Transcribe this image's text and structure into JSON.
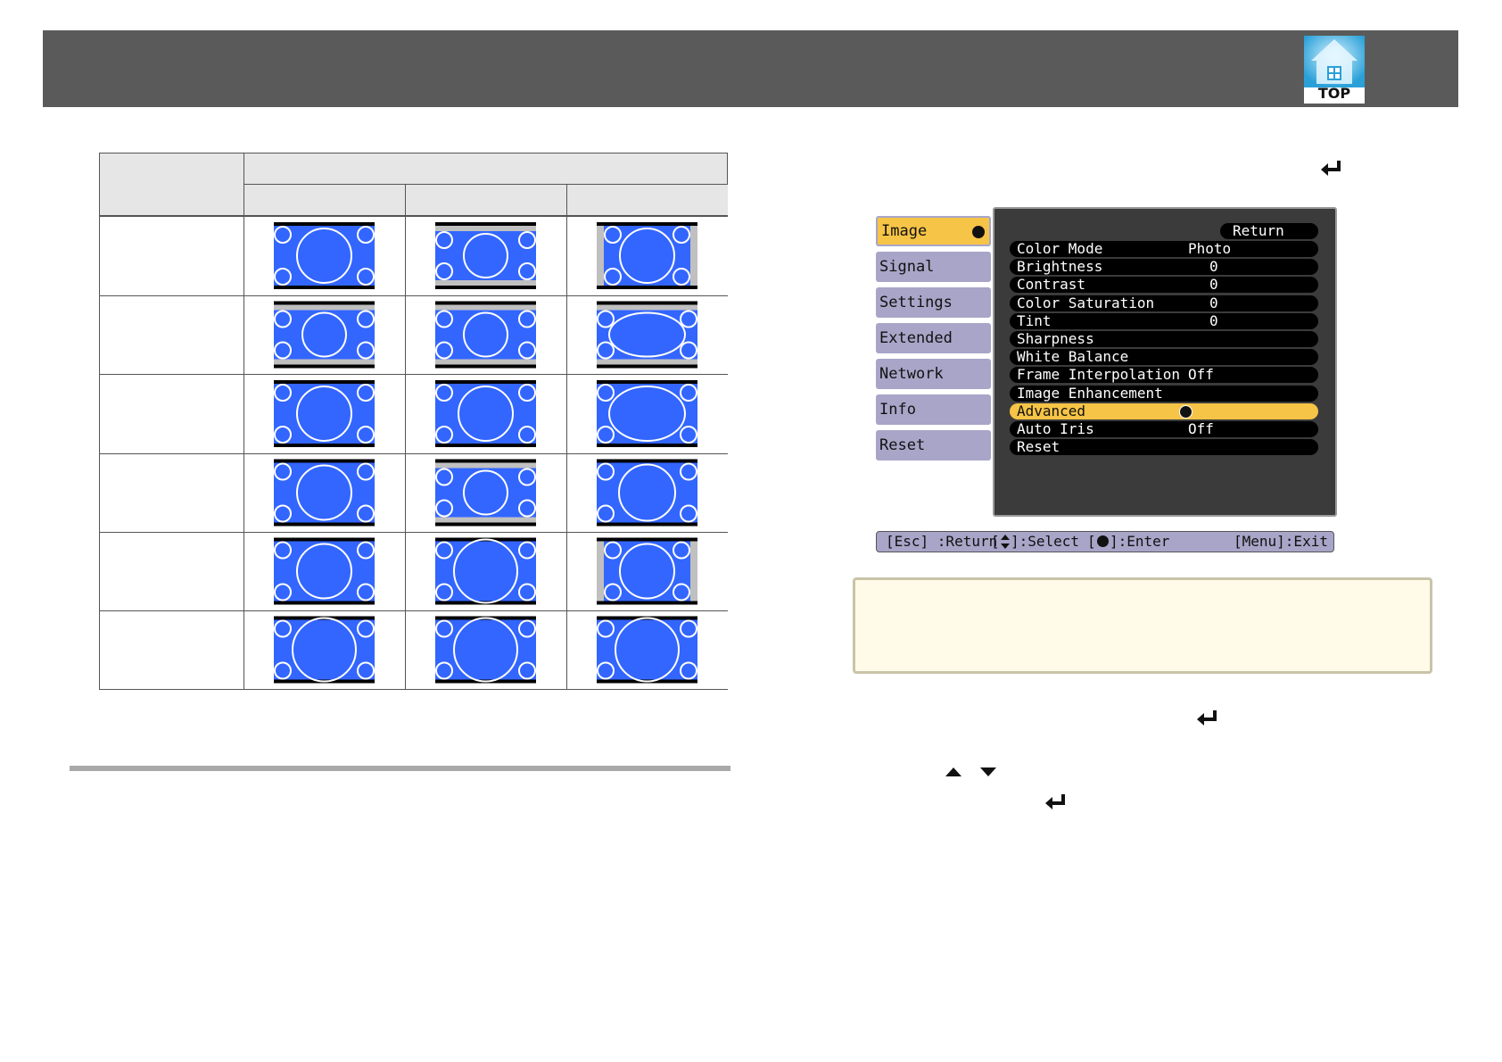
{
  "header": {
    "logo_label": "TOP",
    "logo_icon": "home-icon"
  },
  "aspect_table": {
    "rows": 6,
    "columns": 3,
    "colors": {
      "screen": "#3366ff",
      "letterbox": "#000000",
      "sidebar": "#c0c0c0"
    }
  },
  "menu": {
    "tabs": [
      "Image",
      "Signal",
      "Settings",
      "Extended",
      "Network",
      "Info",
      "Reset"
    ],
    "active_tab": "Image",
    "return_label": "Return",
    "items": [
      {
        "label": "Color Mode",
        "value": "Photo"
      },
      {
        "label": "Brightness",
        "value": "0"
      },
      {
        "label": "Contrast",
        "value": "0"
      },
      {
        "label": "Color Saturation",
        "value": "0"
      },
      {
        "label": "Tint",
        "value": "0"
      },
      {
        "label": "Sharpness",
        "value": ""
      },
      {
        "label": "White Balance",
        "value": ""
      },
      {
        "label": "Frame Interpolation",
        "value": "Off"
      },
      {
        "label": "Image Enhancement",
        "value": ""
      },
      {
        "label": "Advanced",
        "value": ""
      },
      {
        "label": "Auto Iris",
        "value": "Off"
      },
      {
        "label": "Reset",
        "value": ""
      }
    ],
    "highlighted_item": "Advanced",
    "footer": {
      "esc": "[Esc] :Return",
      "select_pre": "[",
      "select_post": "]:Select",
      "enter_pre": "[",
      "enter_post": "]:Enter",
      "exit": "[Menu]:Exit"
    },
    "colors": {
      "tab": "#a8a5c8",
      "active": "#f6c446",
      "panel": "#3b3b3b"
    }
  },
  "icons": [
    "enter-icon",
    "up-arrow-icon",
    "down-arrow-icon"
  ]
}
